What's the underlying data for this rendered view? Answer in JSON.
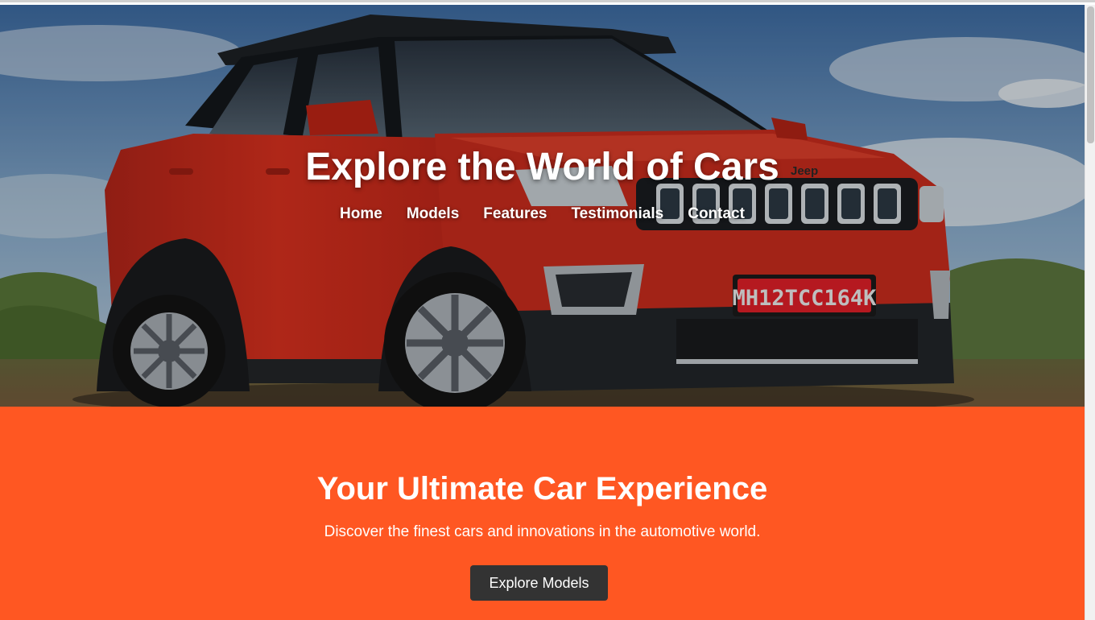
{
  "hero": {
    "title": "Explore the World of Cars",
    "nav": [
      "Home",
      "Models",
      "Features",
      "Testimonials",
      "Contact"
    ],
    "license_plate": "MH12TCC164K",
    "badge": "Jeep"
  },
  "promo": {
    "title": "Your Ultimate Car Experience",
    "subtitle": "Discover the finest cars and innovations in the automotive world.",
    "button_label": "Explore Models"
  },
  "colors": {
    "accent": "#ff5722",
    "button": "#333333",
    "car_body": "#d42b1c"
  }
}
